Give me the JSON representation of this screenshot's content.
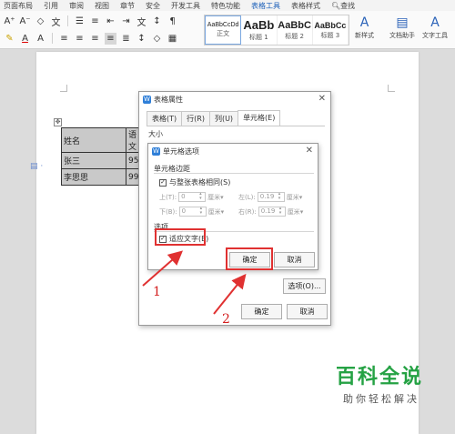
{
  "menubar": {
    "items": [
      "页面布局",
      "引用",
      "审阅",
      "视图",
      "章节",
      "安全",
      "开发工具",
      "特色功能",
      "表格工具",
      "表格样式",
      "查找"
    ],
    "active_index": 8
  },
  "ribbon": {
    "styles": [
      {
        "sample": "AaBbCcDd",
        "name": "正文"
      },
      {
        "sample": "AaBb",
        "name": "标题 1"
      },
      {
        "sample": "AaBbC",
        "name": "标题 2"
      },
      {
        "sample": "AaBbCc",
        "name": "标题 3"
      }
    ],
    "new_style": "新样式",
    "doc_assistant": "文档助手",
    "text_tools": "文字工具"
  },
  "doc_table": {
    "rows": [
      [
        "姓名",
        "语文"
      ],
      [
        "张三",
        "95"
      ],
      [
        "李思思",
        "99"
      ]
    ]
  },
  "table_props": {
    "title": "表格属性",
    "tabs": [
      "表格(T)",
      "行(R)",
      "列(U)",
      "单元格(E)"
    ],
    "size_label": "大小",
    "options_button": "选项(O)...",
    "ok": "确定",
    "cancel": "取消"
  },
  "cell_options": {
    "title": "单元格选项",
    "margin_group": "单元格边距",
    "same_as_table": "与整张表格相同(S)",
    "top_label": "上(T):",
    "top_value": "0",
    "bottom_label": "下(B):",
    "bottom_value": "0",
    "left_label": "左(L):",
    "left_value": "0.19",
    "right_label": "右(R):",
    "right_value": "0.19",
    "unit": "厘米",
    "options_group": "选项",
    "fit_text": "适应文字(E)",
    "ok": "确定",
    "cancel": "取消"
  },
  "annotations": {
    "step1": "1",
    "step2": "2",
    "color": "#e03131"
  },
  "watermark": {
    "title": "百科全说",
    "subtitle": "助你轻松解决"
  }
}
